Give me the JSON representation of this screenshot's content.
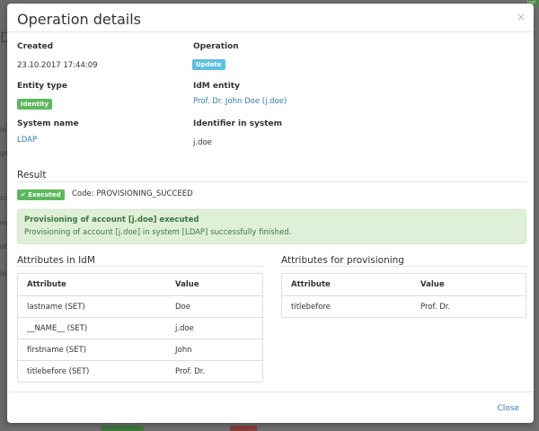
{
  "background": {
    "letter_d": "D",
    "frag_in": "in",
    "frag_ge": "ge",
    "frag_ss": "ss",
    "frag_m": "m",
    "frag_or": "or",
    "frag_in2": "in",
    "badge_text": "Inst"
  },
  "modal": {
    "title": "Operation details",
    "close_icon": "×"
  },
  "details": {
    "created_label": "Created",
    "created_value": "23.10.2017 17:44:09",
    "operation_label": "Operation",
    "operation_badge": "Update",
    "entity_type_label": "Entity type",
    "entity_type_badge": "Identity",
    "idm_entity_label": "IdM entity",
    "idm_entity_value": "Prof. Dr. John Doe (j.doe)",
    "system_name_label": "System name",
    "system_name_value": "LDAP",
    "identifier_label": "Identifier in system",
    "identifier_value": "j.doe"
  },
  "result": {
    "title": "Result",
    "badge": "✔ Executed",
    "code": "Code: PROVISIONING_SUCCEED",
    "alert_title": "Provisioning of account [j.doe] executed",
    "alert_text": "Provisioning of account [j.doe] in system [LDAP] successfully finished."
  },
  "attributes_idm": {
    "title": "Attributes in IdM",
    "headers": [
      "Attribute",
      "Value"
    ],
    "rows": [
      [
        "lastname (SET)",
        "Doe"
      ],
      [
        "__NAME__ (SET)",
        "j.doe"
      ],
      [
        "firstname (SET)",
        "John"
      ],
      [
        "titlebefore (SET)",
        "Prof. Dr."
      ]
    ]
  },
  "attributes_prov": {
    "title": "Attributes for provisioning",
    "headers": [
      "Attribute",
      "Value"
    ],
    "rows": [
      [
        "titlebefore",
        "Prof. Dr."
      ]
    ]
  },
  "footer": {
    "close_label": "Close"
  },
  "colors": {
    "info": "#5bc0de",
    "success": "#5cb85c",
    "link": "#337ab7",
    "alert_bg": "#dff0d8",
    "alert_text": "#3c763d"
  }
}
